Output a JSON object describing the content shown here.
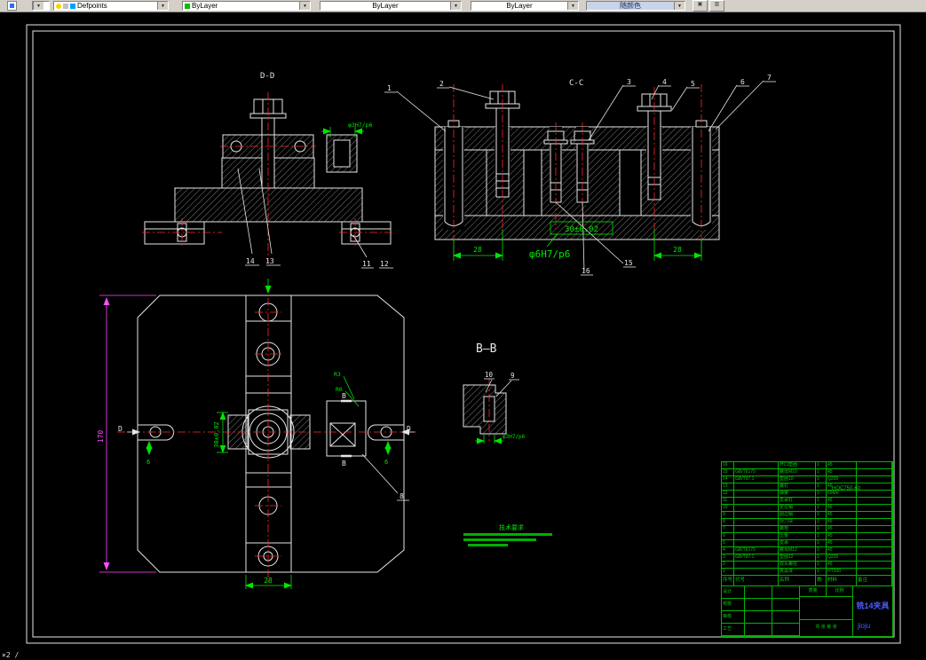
{
  "toolbar": {
    "layer_value": "Defpoints",
    "color_value": "ByLayer",
    "linetype_value": "ByLayer",
    "lineweight_value": "ByLayer",
    "plotstyle_value": "随颜色",
    "dropdown_arrow": "▼"
  },
  "statusbar": {
    "text": "×2 /"
  },
  "drawing": {
    "labels": {
      "view_dd": "D-D",
      "view_cc": "C-C",
      "view_bb": "B—B",
      "dim_phi3_dd": "φ3H7/p6",
      "dim_phi3_bb": "φ3H7/p6",
      "dim_phi6": "φ6H7/p6",
      "dim_30_boxed": "30±0.02",
      "dim_30_plan": "30±0.02",
      "dim_28_cc_left": "28",
      "dim_28_cc_right": "28",
      "dim_28_plan": "28",
      "dim_170": "170",
      "dim_6_left": "6",
      "dim_6_right": "6",
      "r3": "R3",
      "r6": "R6",
      "d_left": "D",
      "d_right": "D",
      "b_top": "B",
      "b_bottom": "B",
      "tech_title": "技术要求"
    },
    "balloons": {
      "1": "1",
      "2": "2",
      "3": "3",
      "4": "4",
      "5": "5",
      "6": "6",
      "7": "7",
      "8": "8",
      "9": "9",
      "10": "10",
      "11": "11",
      "12": "12",
      "13": "13",
      "14": "14",
      "15": "15",
      "16": "16"
    }
  },
  "title_block": {
    "drawing_no": "HQC750-60",
    "title": "铣14夹具",
    "subtitle": "jioju",
    "bom_header": {
      "seq": "序号",
      "code": "代号",
      "name": "名称",
      "qty": "数量",
      "mat": "材料",
      "note": "备注"
    },
    "bom_rows": [
      {
        "seq": "16",
        "code": "",
        "name": "开口垫圈",
        "qty": "1",
        "mat": "45",
        "note": ""
      },
      {
        "seq": "15",
        "code": "GB/T6170",
        "name": "螺母M10",
        "qty": "1",
        "mat": "45",
        "note": ""
      },
      {
        "seq": "14",
        "code": "GB/T97.1",
        "name": "垫圈10",
        "qty": "1",
        "mat": "Q235",
        "note": ""
      },
      {
        "seq": "13",
        "code": "",
        "name": "螺钉",
        "qty": "1",
        "mat": "45",
        "note": ""
      },
      {
        "seq": "12",
        "code": "",
        "name": "弹簧",
        "qty": "1",
        "mat": "65Mn",
        "note": ""
      },
      {
        "seq": "11",
        "code": "",
        "name": "支承钉",
        "qty": "1",
        "mat": "45",
        "note": ""
      },
      {
        "seq": "10",
        "code": "",
        "name": "定位销",
        "qty": "1",
        "mat": "45",
        "note": ""
      },
      {
        "seq": "9",
        "code": "",
        "name": "削边销",
        "qty": "1",
        "mat": "45",
        "note": ""
      },
      {
        "seq": "8",
        "code": "",
        "name": "对刀块",
        "qty": "1",
        "mat": "45",
        "note": ""
      },
      {
        "seq": "7",
        "code": "",
        "name": "螺栓",
        "qty": "1",
        "mat": "45",
        "note": ""
      },
      {
        "seq": "6",
        "code": "",
        "name": "压板",
        "qty": "1",
        "mat": "45",
        "note": ""
      },
      {
        "seq": "5",
        "code": "",
        "name": "支承",
        "qty": "1",
        "mat": "45",
        "note": ""
      },
      {
        "seq": "4",
        "code": "GB/T6170",
        "name": "螺母M12",
        "qty": "1",
        "mat": "45",
        "note": ""
      },
      {
        "seq": "3",
        "code": "GB/T97.1",
        "name": "垫圈12",
        "qty": "1",
        "mat": "Q235",
        "note": ""
      },
      {
        "seq": "2",
        "code": "",
        "name": "双头螺柱",
        "qty": "1",
        "mat": "45",
        "note": ""
      },
      {
        "seq": "1",
        "code": "",
        "name": "夹具体",
        "qty": "1",
        "mat": "HT200",
        "note": ""
      }
    ],
    "sign_labels": [
      "设计",
      "校核",
      "审核",
      "工艺"
    ],
    "mid_labels": {
      "mass": "质量",
      "scale": "比例"
    },
    "sheet_label": "共 张 第 张"
  }
}
